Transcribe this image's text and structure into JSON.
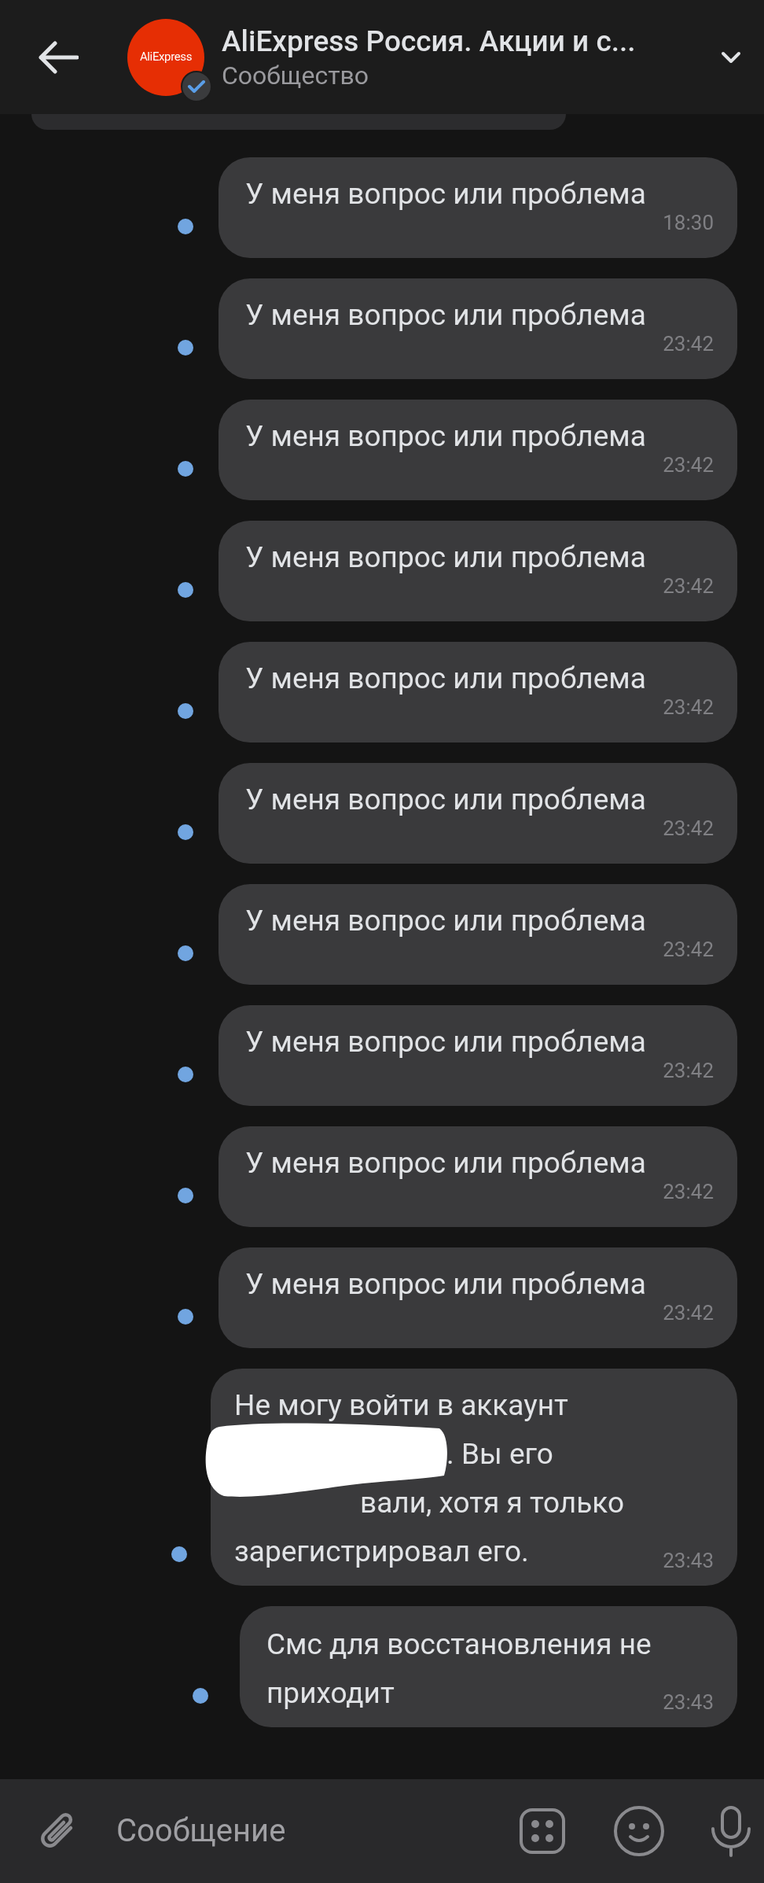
{
  "header": {
    "title": "AliExpress Россия. Акции и с...",
    "subtitle": "Сообщество",
    "avatar_text": "AliExpress",
    "verified": true
  },
  "messages": [
    {
      "lines": [
        {
          "text": "У меня вопрос или проблема"
        }
      ],
      "time": "18:30",
      "read": false
    },
    {
      "lines": [
        {
          "text": "У меня вопрос или проблема"
        }
      ],
      "time": "23:42",
      "read": false
    },
    {
      "lines": [
        {
          "text": "У меня вопрос или проблема"
        }
      ],
      "time": "23:42",
      "read": false
    },
    {
      "lines": [
        {
          "text": "У меня вопрос или проблема"
        }
      ],
      "time": "23:42",
      "read": false
    },
    {
      "lines": [
        {
          "text": "У меня вопрос или проблема"
        }
      ],
      "time": "23:42",
      "read": false
    },
    {
      "lines": [
        {
          "text": "У меня вопрос или проблема"
        }
      ],
      "time": "23:42",
      "read": false
    },
    {
      "lines": [
        {
          "text": "У меня вопрос или проблема"
        }
      ],
      "time": "23:42",
      "read": false
    },
    {
      "lines": [
        {
          "text": "У меня вопрос или проблема"
        }
      ],
      "time": "23:42",
      "read": false
    },
    {
      "lines": [
        {
          "text": "У меня вопрос или проблема"
        }
      ],
      "time": "23:42",
      "read": false
    },
    {
      "lines": [
        {
          "text": "У меня вопрос или проблема"
        }
      ],
      "time": "23:42",
      "read": false
    },
    {
      "lines": [
        {
          "text": "Не могу войти в аккаунт",
          "redacted_before": false
        },
        {
          "text": ". Вы его",
          "redacted_before": true
        },
        {
          "text": "вали, хотя я только",
          "redacted_before": true
        },
        {
          "text": "зарегистрировал его.",
          "redacted_before": false
        }
      ],
      "time": "23:43",
      "read": false
    },
    {
      "lines": [
        {
          "text": "Смс для восстановления не"
        },
        {
          "text": "приходит"
        }
      ],
      "time": "23:43",
      "read": false
    }
  ],
  "composer": {
    "placeholder": "Сообщение"
  }
}
